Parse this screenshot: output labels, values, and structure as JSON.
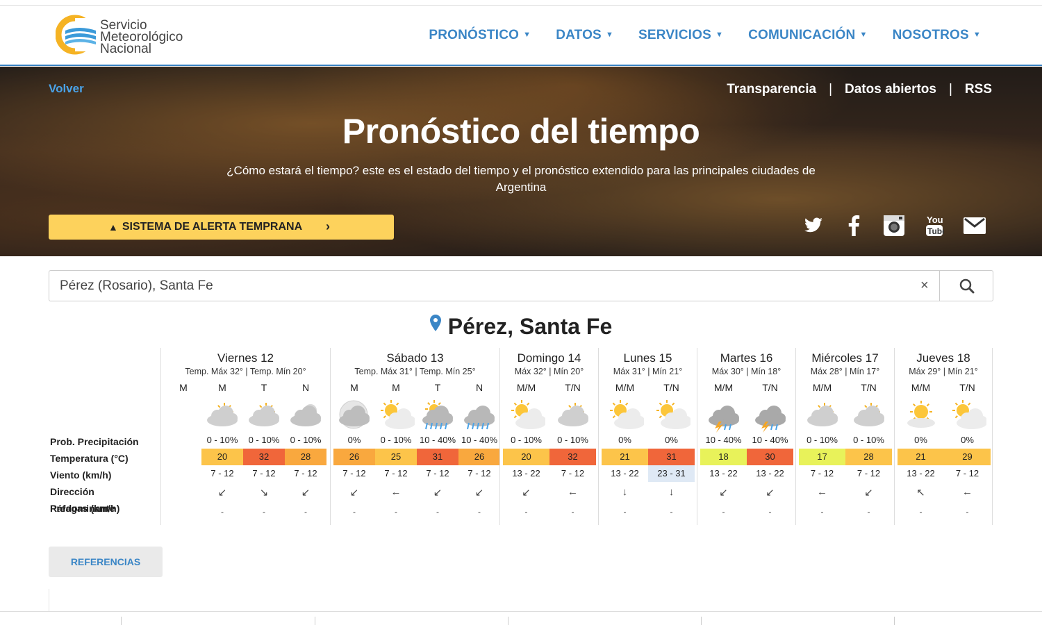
{
  "header": {
    "logo_line1": "Servicio",
    "logo_line2": "Meteorológico",
    "logo_line3": "Nacional",
    "nav": [
      "PRONÓSTICO",
      "DATOS",
      "SERVICIOS",
      "COMUNICACIÓN",
      "NOSOTROS"
    ],
    "accent_color": "#3b86c6"
  },
  "hero": {
    "back_label": "Volver",
    "top_links": [
      "Transparencia",
      "Datos abiertos",
      "RSS"
    ],
    "title": "Pronóstico del tiempo",
    "subtitle": "¿Cómo estará el tiempo? este es el estado del tiempo y el pronóstico extendido para las principales ciudades de Argentina",
    "alert_button": "SISTEMA DE ALERTA TEMPRANA",
    "alert_color": "#fdd25c",
    "social_icons": [
      "twitter-icon",
      "facebook-icon",
      "instagram-icon",
      "youtube-icon",
      "email-icon"
    ]
  },
  "search": {
    "value": "Pérez (Rosario), Santa Fe",
    "clear_label": "×"
  },
  "location": {
    "city": "Pérez, Santa Fe"
  },
  "row_labels": [
    "Prob. Precipitación",
    "Temperatura (°C)",
    "Viento (km/h)",
    "Dirección Predominante",
    "Ráfagas (km/h)"
  ],
  "days": [
    {
      "name": "Viernes 12",
      "temps": "Temp. Máx 32° | Temp. Mín 20°",
      "periods": [
        {
          "label": "M",
          "empty": true
        },
        {
          "label": "M",
          "icon": "partly-cloudy-icon",
          "prob": "0 - 10%",
          "temp": "20",
          "color": "#fcc44a",
          "wind": "7 - 12",
          "dir": "↙",
          "gust": "-"
        },
        {
          "label": "T",
          "icon": "partly-cloudy-icon",
          "prob": "0 - 10%",
          "temp": "32",
          "color": "#f0663a",
          "wind": "7 - 12",
          "dir": "↘",
          "gust": "-"
        },
        {
          "label": "N",
          "icon": "cloudy-night-icon",
          "prob": "0 - 10%",
          "temp": "28",
          "color": "#f9a83e",
          "wind": "7 - 12",
          "dir": "↙",
          "gust": "-"
        }
      ]
    },
    {
      "name": "Sábado 13",
      "temps": "Temp. Máx 31° | Temp. Mín 25°",
      "periods": [
        {
          "label": "M",
          "icon": "cloudy-moon-icon",
          "prob": "0%",
          "temp": "26",
          "color": "#f9a83e",
          "wind": "7 - 12",
          "dir": "↙",
          "gust": "-"
        },
        {
          "label": "M",
          "icon": "sun-cloud-icon",
          "prob": "0 - 10%",
          "temp": "25",
          "color": "#fcc44a",
          "wind": "7 - 12",
          "dir": "←",
          "gust": "-"
        },
        {
          "label": "T",
          "icon": "rain-sun-icon",
          "prob": "10 - 40%",
          "temp": "31",
          "color": "#f0663a",
          "wind": "7 - 12",
          "dir": "↙",
          "gust": "-"
        },
        {
          "label": "N",
          "icon": "rain-icon",
          "prob": "10 - 40%",
          "temp": "26",
          "color": "#f9a83e",
          "wind": "7 - 12",
          "dir": "↙",
          "gust": "-"
        }
      ]
    },
    {
      "name": "Domingo 14",
      "temps": "Máx 32° | Mín 20°",
      "periods": [
        {
          "label": "M/M",
          "icon": "sun-cloud-icon",
          "prob": "0 - 10%",
          "temp": "20",
          "color": "#fcc44a",
          "wind": "13 - 22",
          "dir": "↙",
          "gust": "-"
        },
        {
          "label": "T/N",
          "icon": "partly-cloudy-icon",
          "prob": "0 - 10%",
          "temp": "32",
          "color": "#f0663a",
          "wind": "7 - 12",
          "dir": "←",
          "gust": "-"
        }
      ]
    },
    {
      "name": "Lunes 15",
      "temps": "Máx 31° | Mín 21°",
      "periods": [
        {
          "label": "M/M",
          "icon": "sun-cloud-icon",
          "prob": "0%",
          "temp": "21",
          "color": "#fcc44a",
          "wind": "13 - 22",
          "dir": "↓",
          "gust": "-"
        },
        {
          "label": "T/N",
          "icon": "sun-cloud-icon",
          "prob": "0%",
          "temp": "31",
          "color": "#f0663a",
          "wind": "23 - 31",
          "wind_bg": "#dfe9f5",
          "dir": "↓",
          "gust": "-"
        }
      ]
    },
    {
      "name": "Martes 16",
      "temps": "Máx 30° | Mín 18°",
      "periods": [
        {
          "label": "M/M",
          "icon": "storm-icon",
          "prob": "10 - 40%",
          "temp": "18",
          "color": "#e8f25a",
          "wind": "13 - 22",
          "dir": "↙",
          "gust": "-"
        },
        {
          "label": "T/N",
          "icon": "storm-icon",
          "prob": "10 - 40%",
          "temp": "30",
          "color": "#f0663a",
          "wind": "13 - 22",
          "dir": "↙",
          "gust": "-"
        }
      ]
    },
    {
      "name": "Miércoles 17",
      "temps": "Máx 28° | Mín 17°",
      "periods": [
        {
          "label": "M/M",
          "icon": "partly-cloudy-icon",
          "prob": "0 - 10%",
          "temp": "17",
          "color": "#e8f25a",
          "wind": "7 - 12",
          "dir": "←",
          "gust": "-"
        },
        {
          "label": "T/N",
          "icon": "partly-cloudy-icon",
          "prob": "0 - 10%",
          "temp": "28",
          "color": "#fcc44a",
          "wind": "7 - 12",
          "dir": "↙",
          "gust": "-"
        }
      ]
    },
    {
      "name": "Jueves 18",
      "temps": "Máx 29° | Mín 21°",
      "periods": [
        {
          "label": "M/M",
          "icon": "sunny-icon",
          "prob": "0%",
          "temp": "21",
          "color": "#fcc44a",
          "wind": "13 - 22",
          "dir": "↖",
          "gust": "-"
        },
        {
          "label": "T/N",
          "icon": "sun-cloud-icon",
          "prob": "0%",
          "temp": "29",
          "color": "#fcc44a",
          "wind": "7 - 12",
          "dir": "←",
          "gust": "-"
        }
      ]
    }
  ],
  "references_button": "REFERENCIAS"
}
